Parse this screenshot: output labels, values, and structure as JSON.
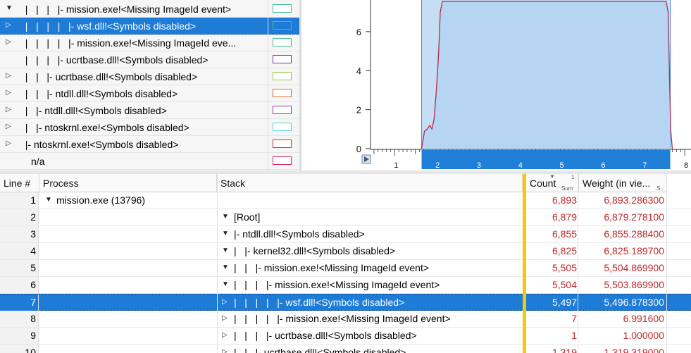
{
  "legend": {
    "rows": [
      {
        "text": "  |   |   |   |- mission.exe!<Missing ImageId event>",
        "expand": "down",
        "color": "#3fbf8f",
        "selected": false
      },
      {
        "text": "  |   |   |   |   |- wsf.dll!<Symbols disabled>",
        "expand": "right",
        "color": "#3fbf8f",
        "selected": true
      },
      {
        "text": "  |   |   |   |   |- mission.exe!<Missing ImageId eve...",
        "expand": "right",
        "color": "#3fbf8f",
        "selected": false
      },
      {
        "text": "  |   |   |   |- ucrtbase.dll!<Symbols disabled>",
        "expand": "",
        "color": "#7b2fbf",
        "selected": false
      },
      {
        "text": "  |   |   |- ucrtbase.dll!<Symbols disabled>",
        "expand": "right",
        "color": "#8fcf2f",
        "selected": false
      },
      {
        "text": "  |   |   |- ntdll.dll!<Symbols disabled>",
        "expand": "right",
        "color": "#d2692a",
        "selected": false
      },
      {
        "text": "  |   |- ntdll.dll!<Symbols disabled>",
        "expand": "right",
        "color": "#a12fbf",
        "selected": false
      },
      {
        "text": "  |   |- ntoskrnl.exe!<Symbols disabled>",
        "expand": "right",
        "color": "#4fd8d8",
        "selected": false
      },
      {
        "text": "  |- ntoskrnl.exe!<Symbols disabled>",
        "expand": "right",
        "color": "#d42a2a",
        "selected": false
      },
      {
        "text": "n/a",
        "expand": "",
        "color": "#d4245a",
        "selected": false
      }
    ]
  },
  "chart_data": {
    "type": "area",
    "title": "",
    "xlabel": "",
    "ylabel": "",
    "x_ticks": [
      "1",
      "2",
      "3",
      "4",
      "5",
      "6",
      "7",
      "8"
    ],
    "y_ticks": [
      "0",
      "2",
      "4",
      "6"
    ],
    "xlim": [
      0.4,
      8.1
    ],
    "ylim": [
      0,
      7.55
    ],
    "selection_range": [
      1.65,
      7.65
    ],
    "series": [
      {
        "color": "#d0283a",
        "x": [
          1.65,
          1.72,
          1.78,
          1.85,
          1.9,
          1.95,
          2.0,
          2.05,
          2.08,
          2.1,
          2.15,
          2.2,
          2.25,
          7.55,
          7.6,
          7.63,
          7.66,
          7.7
        ],
        "y": [
          0.0,
          0.9,
          1.0,
          1.2,
          1.0,
          1.5,
          2.8,
          4.5,
          5.8,
          7.0,
          7.55,
          7.55,
          7.55,
          7.55,
          7.0,
          4.0,
          1.0,
          0.0
        ]
      }
    ]
  },
  "chart_ui": {
    "expander_icon": "expand-icon"
  },
  "table": {
    "columns": {
      "line": "Line #",
      "process": "Process",
      "stack": "Stack",
      "count": "Count",
      "count_sub": "Sum",
      "count_sort_mark": "1",
      "weight": "Weight (in vie...",
      "weight_sub": "S.."
    },
    "rows": [
      {
        "line": "1",
        "process": "mission.exe (13796)",
        "stack": "",
        "indent": "",
        "expand": "down",
        "count": "6,893",
        "weight": "6,893.286300",
        "selected": false
      },
      {
        "line": "2",
        "process": "",
        "stack": "[Root]",
        "indent": "",
        "expand": "down",
        "count": "6,879",
        "weight": "6,879.278100",
        "selected": false
      },
      {
        "line": "3",
        "process": "",
        "stack": "|- ntdll.dll!<Symbols disabled>",
        "indent": "",
        "expand": "down",
        "count": "6,855",
        "weight": "6,855.288400",
        "selected": false
      },
      {
        "line": "4",
        "process": "",
        "stack": "|   |- kernel32.dll!<Symbols disabled>",
        "indent": "",
        "expand": "down",
        "count": "6,825",
        "weight": "6,825.189700",
        "selected": false
      },
      {
        "line": "5",
        "process": "",
        "stack": "|   |   |- mission.exe!<Missing ImageId event>",
        "indent": "",
        "expand": "down",
        "count": "5,505",
        "weight": "5,504.869900",
        "selected": false
      },
      {
        "line": "6",
        "process": "",
        "stack": "|   |   |   |- mission.exe!<Missing ImageId event>",
        "indent": "",
        "expand": "down",
        "count": "5,504",
        "weight": "5,503.869900",
        "selected": false
      },
      {
        "line": "7",
        "process": "",
        "stack": "|   |   |   |   |- wsf.dll!<Symbols disabled>",
        "indent": "",
        "expand": "right",
        "count": "5,497",
        "weight": "5,496.878300",
        "selected": true
      },
      {
        "line": "8",
        "process": "",
        "stack": "|   |   |   |   |- mission.exe!<Missing ImageId event>",
        "indent": "",
        "expand": "right",
        "count": "7",
        "weight": "6.991600",
        "selected": false
      },
      {
        "line": "9",
        "process": "",
        "stack": "|   |   |   |- ucrtbase.dll!<Symbols disabled>",
        "indent": "",
        "expand": "right",
        "count": "1",
        "weight": "1.000000",
        "selected": false
      },
      {
        "line": "10",
        "process": "",
        "stack": "|   |   |- ucrtbase.dll!<Symbols disabled>",
        "indent": "",
        "expand": "right",
        "count": "1,319",
        "weight": "1,319.319000",
        "selected": false
      }
    ]
  }
}
